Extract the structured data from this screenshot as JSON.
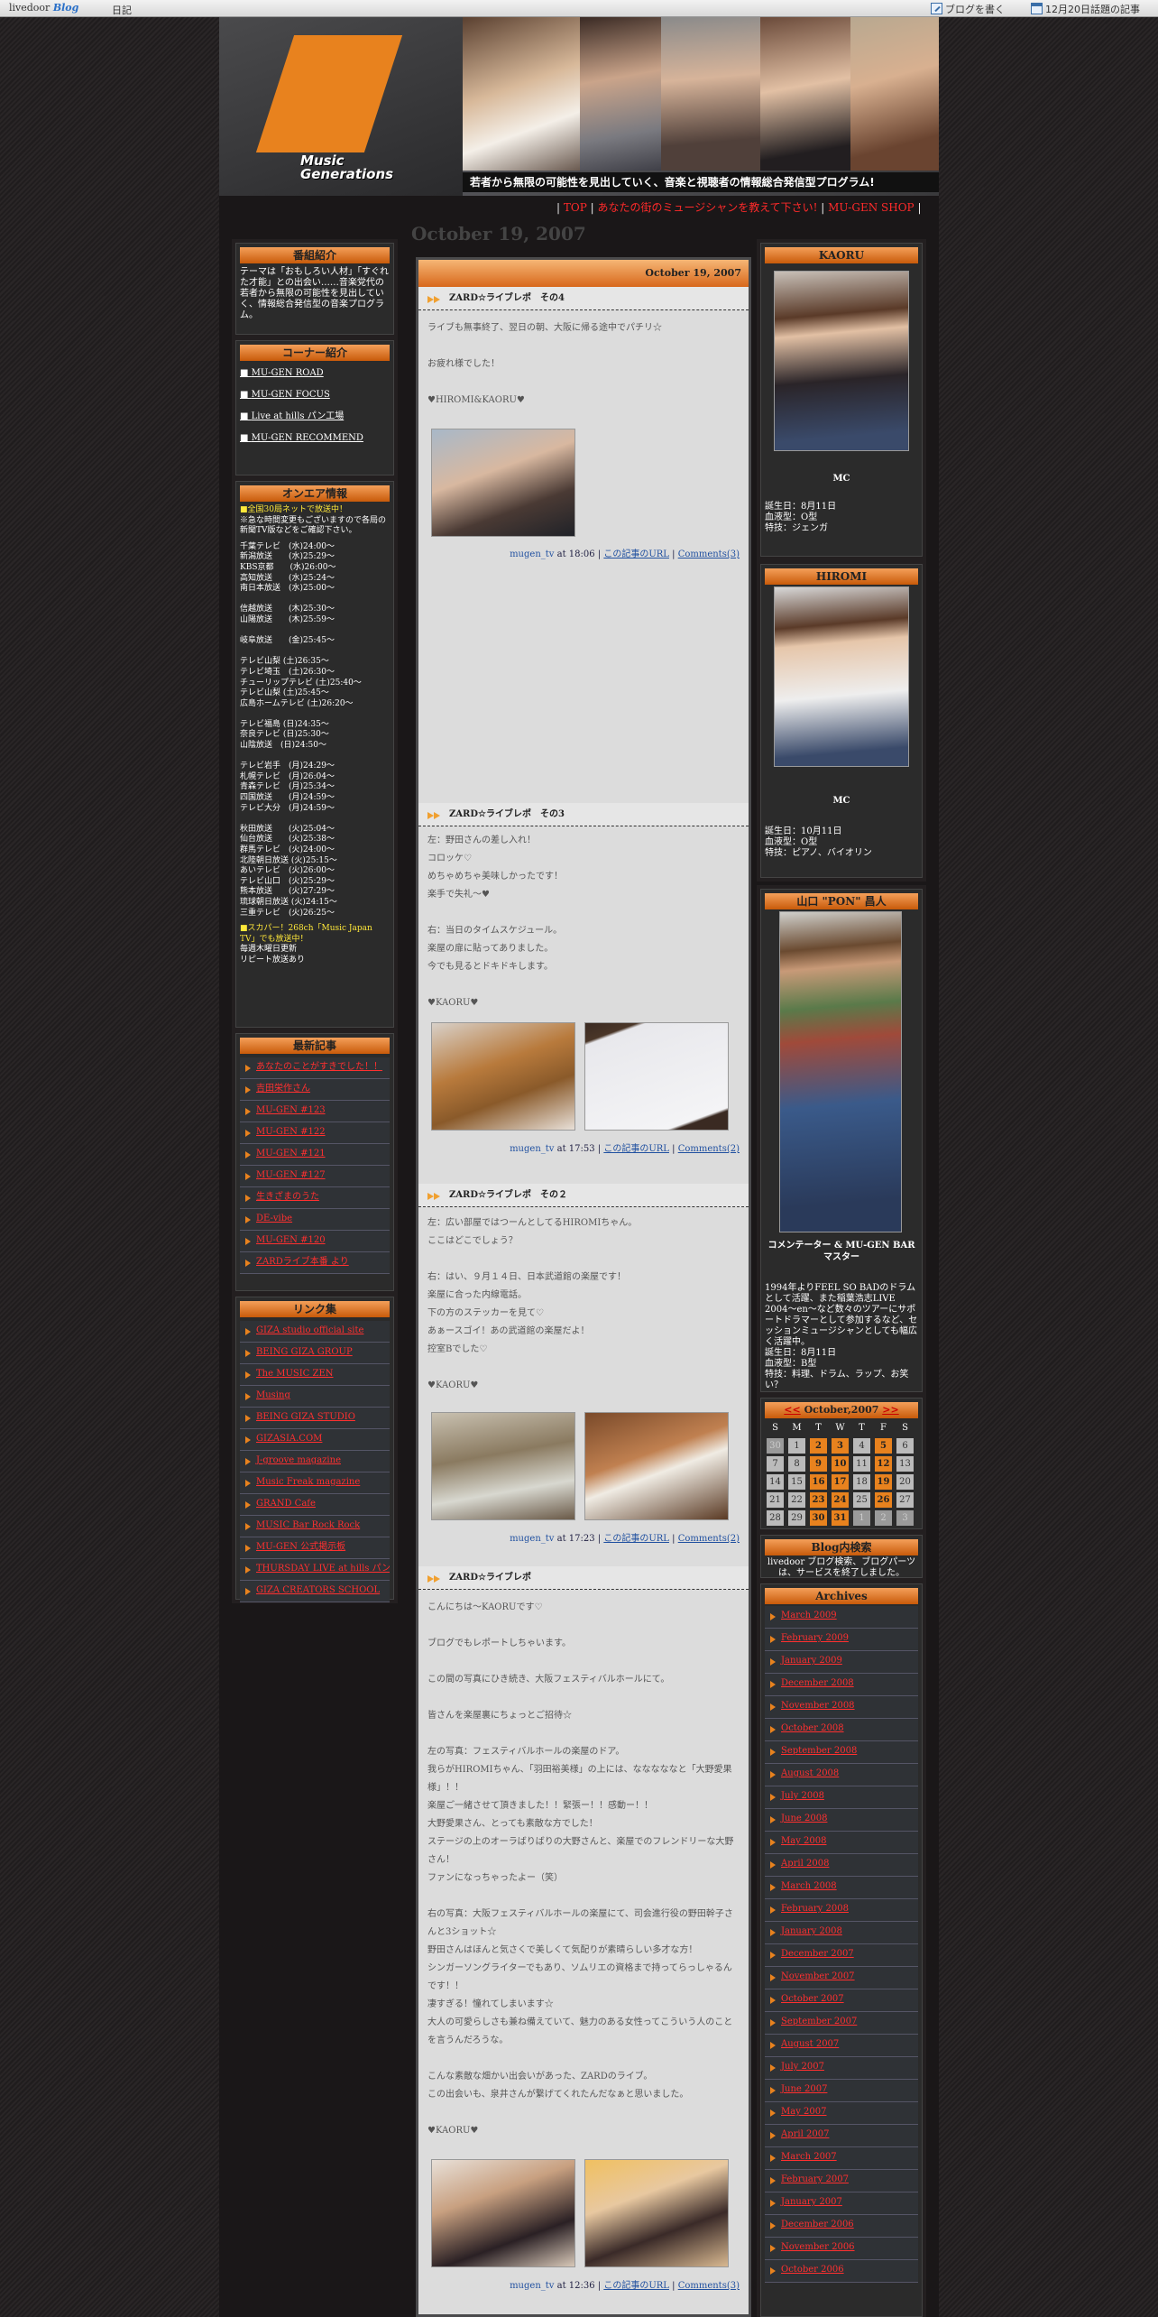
{
  "topbar": {
    "brand": "livedoor",
    "brand_blog": "Blog",
    "diary": "日記",
    "write": "ブログを書く",
    "topic": "12月20日話題の記事"
  },
  "header": {
    "logo_line1": "Music",
    "logo_line2": "Generations",
    "tagline": "若者から無限の可能性を見出していく、音楽と視聴者の情報総合発信型プログラム!"
  },
  "nav": {
    "links": [
      "TOP",
      "あなたの街のミュージシャンを教えて下さい!",
      "MU-GEN SHOP"
    ]
  },
  "date_heading": "October 19, 2007",
  "left": {
    "intro_title": "番組紹介",
    "intro_text": "テーマは「おもしろい人材」「すぐれた才能」との出会い……音楽党代の若者から無限の可能性を見出していく、情報総合発信型の音楽プログラム。",
    "corner_title": "コーナー紹介",
    "corners": [
      "MU-GEN ROAD",
      "MU-GEN FOCUS",
      "Live at hills パン工場",
      "MU-GEN RECOMMEND"
    ],
    "onair_title": "オンエア情報",
    "onair_head": "■全国30局ネットで放送中！",
    "onair_note": "※急な時間変更もございますので各局の新聞TV版などをご確認下さい。",
    "stations": [
      "千葉テレビ　(水)24:00～",
      "新潟放送　　(水)25:29～",
      "KBS京都　　(水)26:00～",
      "高知放送　　(水)25:24～",
      "南日本放送　(水)25:00～",
      "",
      "信越放送　　(木)25:30～",
      "山陽放送　　(木)25:59～",
      "",
      "岐阜放送　　(金)25:45～",
      "",
      "テレビ山梨 (土)26:35～",
      "テレビ埼玉　(土)26:30～",
      "チューリップテレビ (土)25:40～",
      "テレビ山梨 (土)25:45～",
      "広島ホームテレビ (土)26:20～",
      "",
      "テレビ福島 (日)24:35～",
      "奈良テレビ (日)25:30～",
      "山陰放送　(日)24:50～",
      "",
      "テレビ岩手　(月)24:29～",
      "札幌テレビ　(月)26:04～",
      "青森テレビ　(月)25:34～",
      "四国放送　　(月)24:59～",
      "テレビ大分　(月)24:59～",
      "",
      "秋田放送　　(火)25:04～",
      "仙台放送　　(火)25:38～",
      "群馬テレビ　(火)24:00～",
      "北陸朝日放送 (火)25:15～",
      "あいテレビ　(火)26:00～",
      "テレビ山口　(火)25:29～",
      "熊本放送　　(火)27:29～",
      "琉球朝日放送 (火)24:15～",
      "三重テレビ　(火)26:25～"
    ],
    "skyperfect": "■スカパー！268ch「Music Japan TV」でも放送中！",
    "rerun1": "毎週木曜日更新",
    "rerun2": "リピート放送あり",
    "recent_title": "最新記事",
    "recent": [
      "あなたのことがすきでした！！",
      "吉田栄作さん",
      "MU-GEN #123",
      "MU-GEN #122",
      "MU-GEN #121",
      "MU-GEN #127",
      "生きざまのうた",
      "DE-vibe",
      "MU-GEN #120",
      "ZARDライブ本番 より"
    ],
    "links_title": "リンク集",
    "links": [
      "GIZA studio official site",
      "BEING GIZA GROUP",
      "The MUSIC ZEN",
      "Musing",
      "BEING GIZA STUDIO",
      "GIZASIA.COM",
      "J-groove magazine",
      "Music Freak magazine",
      "GRAND Cafe",
      "MUSIC Bar Rock Rock",
      "MU-GEN 公式掲示板",
      "THURSDAY LIVE at hills パン工場",
      "GIZA CREATORS SCHOOL"
    ]
  },
  "main": {
    "date": "October 19, 2007",
    "entries": [
      {
        "title": "ZARD☆ライブレポ　その4",
        "lines": [
          "ライブも無事終了、翌日の朝、大阪に帰る途中でパチリ☆",
          "",
          "お疲れ様でした！",
          "",
          "♥HIROMI&KAORU♥"
        ],
        "author": "mugen_tv",
        "time": "18:06",
        "url_label": "この記事のURL",
        "comments": "Comments(3)"
      },
      {
        "title": "ZARD☆ライブレポ　その3",
        "lines": [
          "左：野田さんの差し入れ！",
          "コロッケ♡",
          "めちゃめちゃ美味しかったです！",
          "楽手で失礼～♥",
          "",
          "右：当日のタイムスケジュール。",
          "楽屋の扉に貼ってありました。",
          "今でも見るとドキドキします。",
          "",
          "♥KAORU♥"
        ],
        "author": "mugen_tv",
        "time": "17:53",
        "url_label": "この記事のURL",
        "comments": "Comments(2)"
      },
      {
        "title": "ZARD☆ライブレポ　その２",
        "lines": [
          "左：広い部屋ではつーんとしてるHIROMIちゃん。",
          "ここはどこでしょう？",
          "",
          "右：はい、９月１４日、日本武道館の楽屋です！",
          "楽屋に合った内線電話。",
          "下の方のステッカーを見て♡",
          "あぁースゴイ！あの武道館の楽屋だよ！",
          "控室Bでした♡",
          "",
          "♥KAORU♥"
        ],
        "author": "mugen_tv",
        "time": "17:23",
        "url_label": "この記事のURL",
        "comments": "Comments(2)"
      },
      {
        "title": "ZARD☆ライブレポ",
        "lines": [
          "こんにちは〜KAORUです♡",
          "",
          "ブログでもレポートしちゃいます。",
          "",
          "この間の写真にひき続き、大阪フェスティバルホールにて。",
          "",
          "皆さんを楽屋裏にちょっとご招待☆",
          "",
          "左の写真：フェスティバルホールの楽屋のドア。",
          "我らがHIROMIちゃん、「羽田裕美様」の上には、なななななと「大野愛果様」！！",
          "楽屋ご一緒させて頂きました！！緊張ー！！感動ー！！",
          "大野愛果さん、とっても素敵な方でした！",
          "ステージの上のオーラばりばりの大野さんと、楽屋でのフレンドリーな大野さん！",
          "ファンになっちゃったよー（笑）",
          "",
          "右の写真：大阪フェスティバルホールの楽屋にて、司会進行役の野田幹子さんと3ショット☆",
          "野田さんはほんと気さくで美しくて気配りが素晴らしい多才な方！",
          "シンガーソングライターでもあり、ソムリエの資格まで持ってらっしゃるんです！！",
          "凄すぎる！憧れてしまいます☆",
          "大人の可愛らしさも兼ね備えていて、魅力のある女性ってこういう人のことを言うんだろうな。",
          "",
          "こんな素敵な畑かい出会いがあった、ZARDのライブ。",
          "この出会いも、泉井さんが繋げてくれたんだなぁと思いました。",
          "",
          "♥KAORU♥"
        ],
        "author": "mugen_tv",
        "time": "12:36",
        "url_label": "この記事のURL",
        "comments": "Comments(3)"
      }
    ]
  },
  "right": {
    "kaoru_title": "KAORU",
    "kaoru_role": "MC",
    "kaoru_info": [
      "誕生日：8月11日",
      "血液型：O型",
      "特技：ジェンガ"
    ],
    "hiromi_title": "HIROMI",
    "hiromi_role": "MC",
    "hiromi_info": [
      "誕生日：10月11日",
      "血液型：O型",
      "特技：ピアノ、バイオリン"
    ],
    "pon_title": "山口 \"PON\" 昌人",
    "pon_role": "コメンテーター & MU-GEN BARマスター",
    "pon_info": [
      "1994年よりFEEL SO BADのドラムとして活躍、また稲葉浩志LIVE 2004～en～など数々のツアーにサポートドラマーとして参加するなど、セッションミュージシャンとしても幅広く活躍中。",
      "誕生日：8月11日",
      "血液型：B型",
      "特技：料理、ドラム、ラップ、お笑い？"
    ],
    "calendar_title": "October,2007",
    "calendar_prev": "<<",
    "calendar_next": ">>",
    "weekdays": [
      "S",
      "M",
      "T",
      "W",
      "T",
      "F",
      "S"
    ],
    "days": [
      "30",
      "1",
      "2",
      "3",
      "4",
      "5",
      "6",
      "7",
      "8",
      "9",
      "10",
      "11",
      "12",
      "13",
      "14",
      "15",
      "16",
      "17",
      "18",
      "19",
      "20",
      "21",
      "22",
      "23",
      "24",
      "25",
      "26",
      "27",
      "28",
      "29",
      "30",
      "31",
      "1",
      "2",
      "3"
    ],
    "search_title": "Blog内検索",
    "search_text": "livedoor ブログ検索、ブログパーツは、サービスを終了しました。",
    "archives_title": "Archives",
    "archives": [
      "March 2009",
      "February 2009",
      "January 2009",
      "December 2008",
      "November 2008",
      "October 2008",
      "September 2008",
      "August 2008",
      "July 2008",
      "June 2008",
      "May 2008",
      "April 2008",
      "March 2008",
      "February 2008",
      "January 2008",
      "December 2007",
      "November 2007",
      "October 2007",
      "September 2007",
      "August 2007",
      "July 2007",
      "June 2007",
      "May 2007",
      "April 2007",
      "March 2007",
      "February 2007",
      "January 2007",
      "December 2006",
      "November 2006",
      "October 2006"
    ]
  },
  "colors": {
    "accent": "#e8821e",
    "link_red": "#ff2a2a",
    "bg": "#1e1b1c"
  }
}
